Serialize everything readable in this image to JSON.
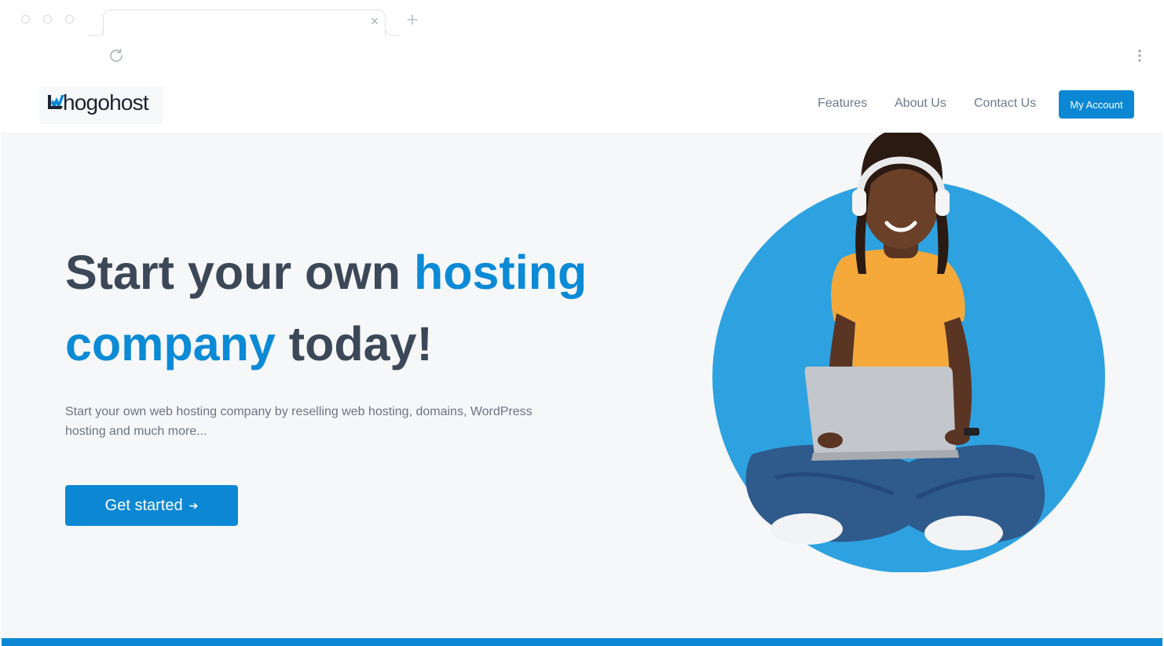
{
  "browser": {
    "tab_close_icon": "close-icon",
    "new_tab_icon": "plus-icon",
    "reload_icon": "reload-icon",
    "menu_icon": "kebab-menu-icon",
    "new_tab_glyph": "+",
    "tab_close_glyph": "×"
  },
  "header": {
    "logo_text": "hogohost",
    "nav": [
      "Features",
      "About Us",
      "Contact Us"
    ],
    "account_button": "My Account"
  },
  "hero": {
    "title_part1": "Start your own ",
    "title_highlight1": "hosting company",
    "title_part2": " today!",
    "subtitle": "Start your own web hosting company by reselling web hosting, domains, WordPress hosting and much more...",
    "cta_label": "Get started",
    "cta_arrow": "➔"
  },
  "colors": {
    "accent": "#0b87d4",
    "heading": "#3c4858",
    "hero_bg": "#f6f7f9",
    "circle": "#2ea2e0",
    "shirt": "#f5a93b"
  }
}
